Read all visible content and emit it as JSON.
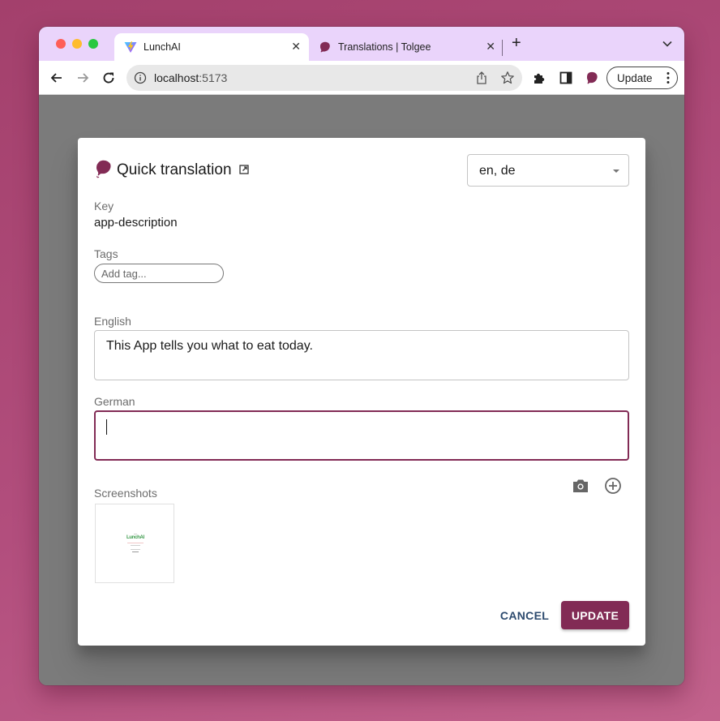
{
  "browser": {
    "tabs": [
      {
        "title": "LunchAI",
        "favicon": "vite-logo-icon",
        "active": true
      },
      {
        "title": "Translations | Tolgee",
        "favicon": "tolgee-mouse-icon",
        "active": false
      }
    ],
    "address_bar": {
      "host": "localhost",
      "port": ":5173"
    },
    "update_label": "Update"
  },
  "dialog": {
    "title": "Quick translation",
    "language_select": {
      "value": "en, de"
    },
    "key": {
      "label": "Key",
      "value": "app-description"
    },
    "tags": {
      "label": "Tags",
      "placeholder": "Add tag..."
    },
    "translations": [
      {
        "label": "English",
        "value": "This App tells you what to eat today.",
        "focused": false
      },
      {
        "label": "German",
        "value": "",
        "focused": true
      }
    ],
    "screenshots": {
      "label": "Screenshots",
      "thumbnail_text": "LunchAI"
    },
    "buttons": {
      "cancel": "CANCEL",
      "update": "UPDATE"
    }
  },
  "colors": {
    "brand": "#822b55",
    "cancel_text": "#2c4a6e",
    "tabbar": "#ead4fb"
  }
}
